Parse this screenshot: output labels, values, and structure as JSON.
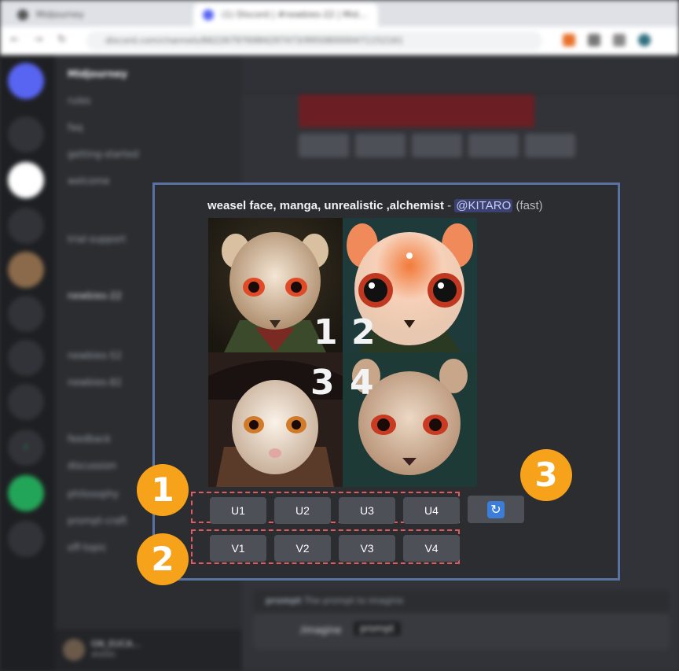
{
  "browser": {
    "tabs": [
      {
        "title": "Midjourney"
      },
      {
        "title": "(1) Discord | #newbies-22 | Mid…"
      }
    ],
    "url": "discord.com/channels/662267976984297473/995080000471152161"
  },
  "discord": {
    "server_name": "Midjourney",
    "channels": [
      "rules",
      "faq",
      "getting-started",
      "welcome",
      "trial-support",
      "newbies-22",
      "newbies-52",
      "newbies-82",
      "feedback",
      "discussion",
      "philosophy",
      "prompt-craft",
      "off-topic"
    ],
    "user": {
      "name": "GN_EUCA...",
      "tag": "#0000"
    },
    "input": {
      "command": "/imagine",
      "param": "prompt",
      "hint_label": "prompt",
      "hint_text": "The prompt to imagine"
    }
  },
  "panel": {
    "prompt_text": "weasel face, manga, unrealistic ,alchemist",
    "separator": " - ",
    "mention": "@KITARO",
    "mode": "(fast)",
    "grid_numbers": [
      "1",
      "2",
      "3",
      "4"
    ],
    "upscale_buttons": [
      "U1",
      "U2",
      "U3",
      "U4"
    ],
    "variation_buttons": [
      "V1",
      "V2",
      "V3",
      "V4"
    ],
    "reroll_icon": "refresh-icon",
    "badges": [
      "1",
      "2",
      "3"
    ],
    "accent": "#5873a3",
    "badge_color": "#f6a21a",
    "highlight_color": "#e25a5e"
  }
}
